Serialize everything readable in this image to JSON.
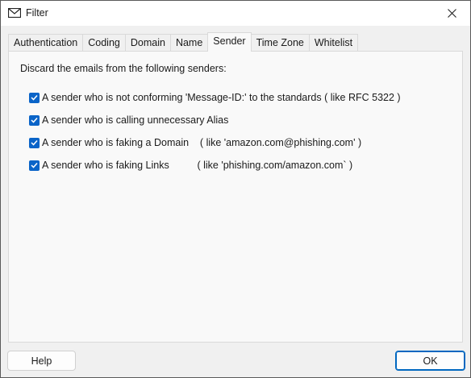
{
  "window": {
    "title": "Filter"
  },
  "tabs": [
    {
      "label": "Authentication",
      "active": false
    },
    {
      "label": "Coding",
      "active": false
    },
    {
      "label": "Domain",
      "active": false
    },
    {
      "label": "Name",
      "active": false
    },
    {
      "label": "Sender",
      "active": true
    },
    {
      "label": "Time Zone",
      "active": false
    },
    {
      "label": "Whitelist",
      "active": false
    }
  ],
  "panel": {
    "heading": "Discard the emails from the following senders:",
    "options": [
      {
        "label": "A sender who is not conforming 'Message-ID:' to the standards ( like RFC 5322 )",
        "checked": true
      },
      {
        "label": "A sender who is calling unnecessary Alias",
        "checked": true
      },
      {
        "label": "A sender who is faking a Domain    ( like 'amazon.com@phishing.com' )",
        "checked": true
      },
      {
        "label": "A sender who is faking Links          ( like 'phishing.com/amazon.com` )",
        "checked": true
      }
    ]
  },
  "buttons": {
    "help": "Help",
    "ok": "OK"
  },
  "colors": {
    "accent": "#0a64c8",
    "ok_border": "#0067c0",
    "panel_bg": "#f9f9f9",
    "window_bg": "#f0f0f0"
  }
}
